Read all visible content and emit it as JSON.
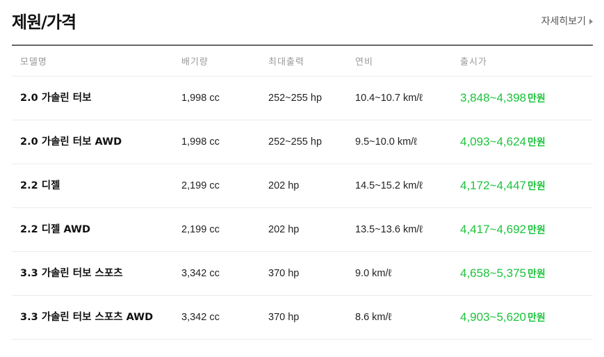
{
  "header": {
    "title": "제원/가격",
    "more_label": "자세히보기"
  },
  "table": {
    "columns": [
      "모델명",
      "배기량",
      "최대출력",
      "연비",
      "출시가"
    ],
    "price_unit": "만원",
    "rows": [
      {
        "model": "2.0 가솔린 터보",
        "displacement": "1,998 cc",
        "power": "252~255 hp",
        "fuel": "10.4~10.7 km/ℓ",
        "price": "3,848~4,398"
      },
      {
        "model": "2.0 가솔린 터보 AWD",
        "displacement": "1,998 cc",
        "power": "252~255 hp",
        "fuel": "9.5~10.0 km/ℓ",
        "price": "4,093~4,624"
      },
      {
        "model": "2.2 디젤",
        "displacement": "2,199 cc",
        "power": "202 hp",
        "fuel": "14.5~15.2 km/ℓ",
        "price": "4,172~4,447"
      },
      {
        "model": "2.2 디젤 AWD",
        "displacement": "2,199 cc",
        "power": "202 hp",
        "fuel": "13.5~13.6 km/ℓ",
        "price": "4,417~4,692"
      },
      {
        "model": "3.3 가솔린 터보 스포츠",
        "displacement": "3,342 cc",
        "power": "370 hp",
        "fuel": "9.0 km/ℓ",
        "price": "4,658~5,375"
      },
      {
        "model": "3.3 가솔린 터보 스포츠 AWD",
        "displacement": "3,342 cc",
        "power": "370 hp",
        "fuel": "8.6 km/ℓ",
        "price": "4,903~5,620"
      }
    ]
  },
  "colors": {
    "price_green": "#1bc33b",
    "header_line": "#666666"
  }
}
